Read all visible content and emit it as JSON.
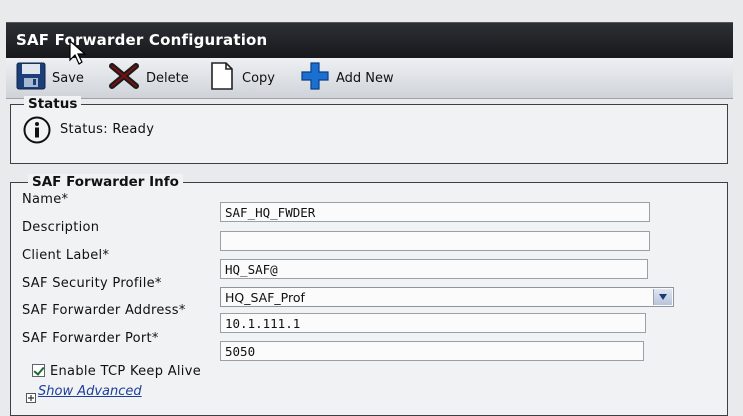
{
  "header": {
    "title": "SAF Forwarder Configuration"
  },
  "toolbar": {
    "save_label": "Save",
    "delete_label": "Delete",
    "copy_label": "Copy",
    "add_new_label": "Add New"
  },
  "status": {
    "legend": "Status",
    "text": "Status: Ready"
  },
  "info": {
    "legend": "SAF Forwarder Info",
    "fields": {
      "name": {
        "label": "Name*",
        "value": "SAF_HQ_FWDER"
      },
      "description": {
        "label": "Description",
        "value": ""
      },
      "client_label": {
        "label": "Client Label*",
        "value": "HQ_SAF@"
      },
      "security_profile": {
        "label": "SAF Security Profile*",
        "value": "HQ_SAF_Prof"
      },
      "address": {
        "label": "SAF Forwarder Address*",
        "value": "10.1.111.1"
      },
      "port": {
        "label": "SAF Forwarder Port*",
        "value": "5050"
      }
    },
    "keepalive_label": "Enable TCP Keep Alive",
    "show_advanced_label": "Show Advanced"
  },
  "colors": {
    "title_bar": "#16181b",
    "link": "#1e3e9a",
    "add_icon": "#1b6fd0",
    "delete_icon": "#1a1a1a"
  }
}
